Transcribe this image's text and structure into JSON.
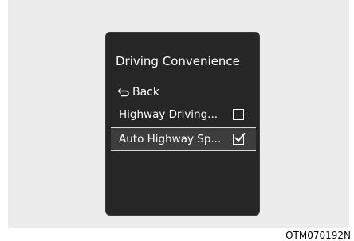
{
  "screen": {
    "title": "Driving Convenience",
    "back_label": "Back",
    "items": [
      {
        "label": "Highway Driving...",
        "checked": false
      },
      {
        "label": "Auto Highway Sp...",
        "checked": true,
        "selected": true
      }
    ]
  },
  "caption": "OTM070192N"
}
